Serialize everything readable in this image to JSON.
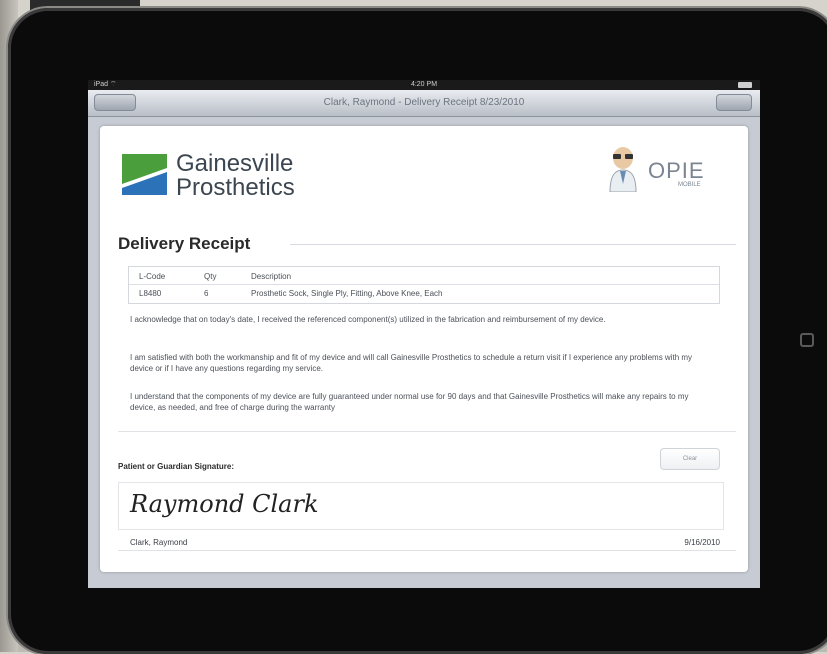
{
  "status_bar": {
    "carrier": "iPad ⌔",
    "time": "4:20 PM"
  },
  "nav": {
    "title": "Clark, Raymond - Delivery Receipt 8/23/2010"
  },
  "header": {
    "brand_line1": "Gainesville",
    "brand_line2": "Prosthetics",
    "opie_name": "OPIE",
    "opie_sub": "MOBILE"
  },
  "receipt": {
    "title": "Delivery Receipt",
    "columns": [
      "L-Code",
      "Qty",
      "Description"
    ],
    "rows": [
      {
        "lcode": "L8480",
        "qty": "6",
        "description": "Prosthetic Sock, Single Ply, Fitting, Above Knee, Each"
      }
    ],
    "paragraphs": [
      "I acknowledge that on today's date, I received the referenced component(s) utilized in the fabrication and reimbursement of my device.",
      "I am satisfied with both the workmanship and fit of my device and will call Gainesville Prosthetics to schedule a return visit if I experience any problems with my device or if I have any questions regarding my service.",
      "I understand that the components of my device are fully guaranteed under normal use for 90 days and that Gainesville Prosthetics will make any repairs to my device, as needed, and free of charge during the warranty"
    ]
  },
  "signature": {
    "label": "Patient or Guardian Signature:",
    "clear_label": "Clear",
    "signed_name": "Raymond Clark",
    "signer": "Clark, Raymond",
    "date": "9/16/2010"
  },
  "colors": {
    "bezel": "#0b0b0b",
    "navbar": "#b9bfc8",
    "logo_green": "#4a9e3c",
    "logo_blue": "#2b72b8"
  }
}
